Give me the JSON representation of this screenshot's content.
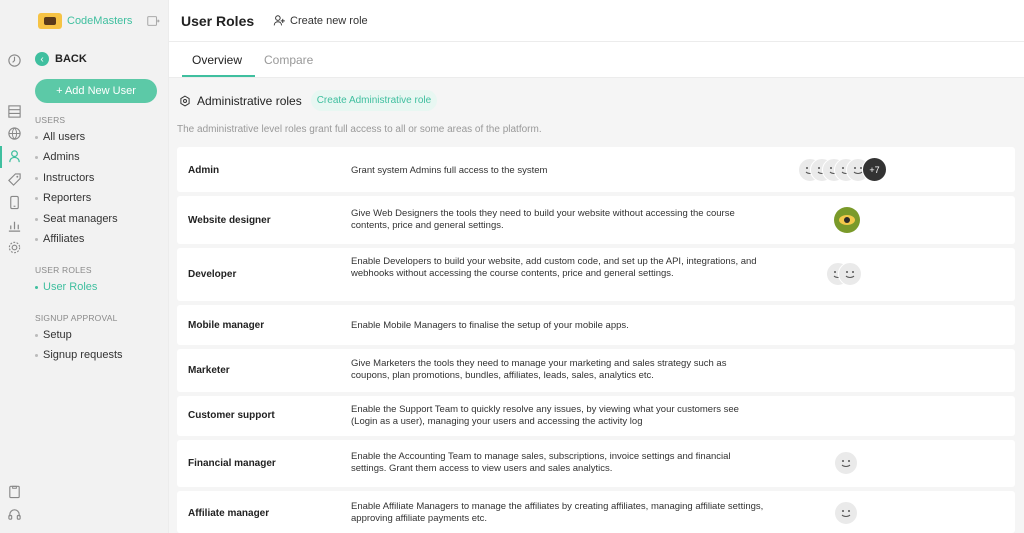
{
  "app": {
    "name": "CodeMasters"
  },
  "sidebar": {
    "back_label": "BACK",
    "add_user_label": "+ Add New User",
    "sections": [
      {
        "title": "USERS",
        "items": [
          "All users",
          "Admins",
          "Instructors",
          "Reporters",
          "Seat managers",
          "Affiliates"
        ]
      },
      {
        "title": "USER ROLES",
        "items": [
          "User Roles"
        ]
      },
      {
        "title": "SIGNUP APPROVAL",
        "items": [
          "Setup",
          "Signup requests"
        ]
      }
    ],
    "active_item": "User Roles"
  },
  "header": {
    "title": "User Roles",
    "create_label": "Create new role"
  },
  "tabs": [
    {
      "label": "Overview",
      "active": true
    },
    {
      "label": "Compare",
      "active": false
    }
  ],
  "section": {
    "title": "Administrative roles",
    "create_button": "Create Administrative role",
    "description": "The administrative level roles grant full access to all or some areas of the platform."
  },
  "roles": [
    {
      "name": "Admin",
      "description": "Grant system Admins full access to the system",
      "avatars": {
        "count_shown": 5,
        "more": "+7"
      }
    },
    {
      "name": "Website designer",
      "description": "Give Web Designers the tools they need to build your website without accessing the course contents, price and general settings.",
      "avatars": {
        "type": "eye-icon"
      }
    },
    {
      "name": "Developer",
      "description": "Enable Developers to build your website, add custom code, and set up the API, integrations, and webhooks without accessing the course contents, price and general settings.",
      "avatars": {
        "count_shown": 2
      }
    },
    {
      "name": "Mobile manager",
      "description": "Enable Mobile Managers to finalise the setup of your mobile apps."
    },
    {
      "name": "Marketer",
      "description": "Give Marketers the tools they need to manage your marketing and sales strategy such as coupons, plan promotions, bundles, affiliates, leads, sales, analytics etc."
    },
    {
      "name": "Customer support",
      "description": "Enable the Support Team to quickly resolve any issues, by viewing what your customers see (Login as a user), managing your users and accessing the activity log"
    },
    {
      "name": "Financial manager",
      "description": "Enable the Accounting Team to manage sales, subscriptions, invoice settings and financial settings. Grant them access to view users and sales analytics.",
      "avatars": {
        "count_shown": 1
      }
    },
    {
      "name": "Affiliate manager",
      "description": "Enable Affiliate Managers to manage the affiliates by creating affiliates, managing affiliate settings, approving affiliate payments etc.",
      "avatars": {
        "count_shown": 1
      }
    }
  ],
  "colors": {
    "accent": "#3fbf9f",
    "accent_light": "#e8f7f2",
    "button": "#5cc9a7"
  }
}
